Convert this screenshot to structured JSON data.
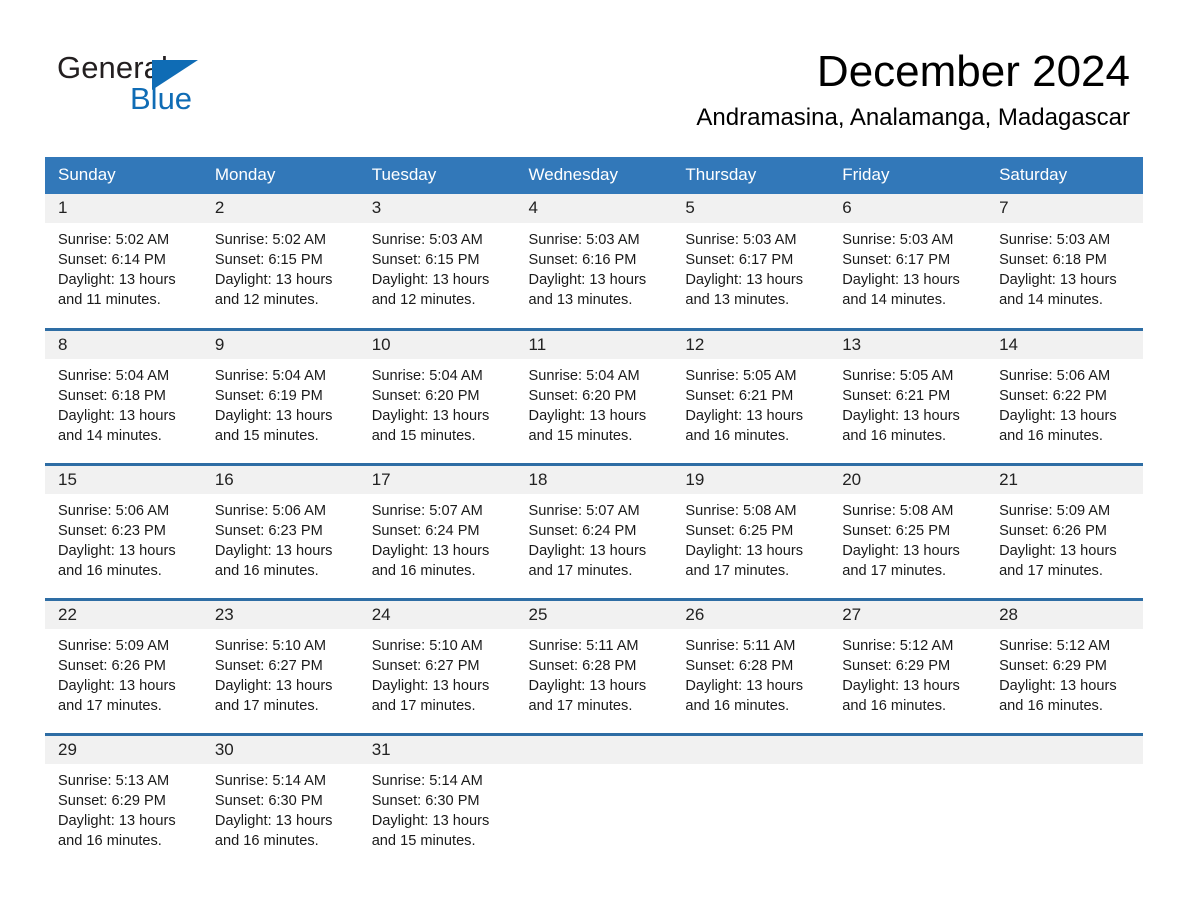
{
  "brand": {
    "name_part1": "General",
    "name_part2": "Blue",
    "accent_color": "#0f6cb5"
  },
  "header": {
    "title": "December 2024",
    "subtitle": "Andramasina, Analamanga, Madagascar"
  },
  "theme": {
    "header_row_bg": "#3278b9",
    "row_divider": "#2e6da4",
    "daynum_bg": "#f1f1f1",
    "page_bg": "#ffffff"
  },
  "weekday_headers": [
    "Sunday",
    "Monday",
    "Tuesday",
    "Wednesday",
    "Thursday",
    "Friday",
    "Saturday"
  ],
  "labels": {
    "sunrise_prefix": "Sunrise:",
    "sunset_prefix": "Sunset:",
    "daylight_prefix": "Daylight:"
  },
  "weeks": [
    [
      {
        "day": "1",
        "sunrise": "Sunrise: 5:02 AM",
        "sunset": "Sunset: 6:14 PM",
        "daylight_l1": "Daylight: 13 hours",
        "daylight_l2": "and 11 minutes."
      },
      {
        "day": "2",
        "sunrise": "Sunrise: 5:02 AM",
        "sunset": "Sunset: 6:15 PM",
        "daylight_l1": "Daylight: 13 hours",
        "daylight_l2": "and 12 minutes."
      },
      {
        "day": "3",
        "sunrise": "Sunrise: 5:03 AM",
        "sunset": "Sunset: 6:15 PM",
        "daylight_l1": "Daylight: 13 hours",
        "daylight_l2": "and 12 minutes."
      },
      {
        "day": "4",
        "sunrise": "Sunrise: 5:03 AM",
        "sunset": "Sunset: 6:16 PM",
        "daylight_l1": "Daylight: 13 hours",
        "daylight_l2": "and 13 minutes."
      },
      {
        "day": "5",
        "sunrise": "Sunrise: 5:03 AM",
        "sunset": "Sunset: 6:17 PM",
        "daylight_l1": "Daylight: 13 hours",
        "daylight_l2": "and 13 minutes."
      },
      {
        "day": "6",
        "sunrise": "Sunrise: 5:03 AM",
        "sunset": "Sunset: 6:17 PM",
        "daylight_l1": "Daylight: 13 hours",
        "daylight_l2": "and 14 minutes."
      },
      {
        "day": "7",
        "sunrise": "Sunrise: 5:03 AM",
        "sunset": "Sunset: 6:18 PM",
        "daylight_l1": "Daylight: 13 hours",
        "daylight_l2": "and 14 minutes."
      }
    ],
    [
      {
        "day": "8",
        "sunrise": "Sunrise: 5:04 AM",
        "sunset": "Sunset: 6:18 PM",
        "daylight_l1": "Daylight: 13 hours",
        "daylight_l2": "and 14 minutes."
      },
      {
        "day": "9",
        "sunrise": "Sunrise: 5:04 AM",
        "sunset": "Sunset: 6:19 PM",
        "daylight_l1": "Daylight: 13 hours",
        "daylight_l2": "and 15 minutes."
      },
      {
        "day": "10",
        "sunrise": "Sunrise: 5:04 AM",
        "sunset": "Sunset: 6:20 PM",
        "daylight_l1": "Daylight: 13 hours",
        "daylight_l2": "and 15 minutes."
      },
      {
        "day": "11",
        "sunrise": "Sunrise: 5:04 AM",
        "sunset": "Sunset: 6:20 PM",
        "daylight_l1": "Daylight: 13 hours",
        "daylight_l2": "and 15 minutes."
      },
      {
        "day": "12",
        "sunrise": "Sunrise: 5:05 AM",
        "sunset": "Sunset: 6:21 PM",
        "daylight_l1": "Daylight: 13 hours",
        "daylight_l2": "and 16 minutes."
      },
      {
        "day": "13",
        "sunrise": "Sunrise: 5:05 AM",
        "sunset": "Sunset: 6:21 PM",
        "daylight_l1": "Daylight: 13 hours",
        "daylight_l2": "and 16 minutes."
      },
      {
        "day": "14",
        "sunrise": "Sunrise: 5:06 AM",
        "sunset": "Sunset: 6:22 PM",
        "daylight_l1": "Daylight: 13 hours",
        "daylight_l2": "and 16 minutes."
      }
    ],
    [
      {
        "day": "15",
        "sunrise": "Sunrise: 5:06 AM",
        "sunset": "Sunset: 6:23 PM",
        "daylight_l1": "Daylight: 13 hours",
        "daylight_l2": "and 16 minutes."
      },
      {
        "day": "16",
        "sunrise": "Sunrise: 5:06 AM",
        "sunset": "Sunset: 6:23 PM",
        "daylight_l1": "Daylight: 13 hours",
        "daylight_l2": "and 16 minutes."
      },
      {
        "day": "17",
        "sunrise": "Sunrise: 5:07 AM",
        "sunset": "Sunset: 6:24 PM",
        "daylight_l1": "Daylight: 13 hours",
        "daylight_l2": "and 16 minutes."
      },
      {
        "day": "18",
        "sunrise": "Sunrise: 5:07 AM",
        "sunset": "Sunset: 6:24 PM",
        "daylight_l1": "Daylight: 13 hours",
        "daylight_l2": "and 17 minutes."
      },
      {
        "day": "19",
        "sunrise": "Sunrise: 5:08 AM",
        "sunset": "Sunset: 6:25 PM",
        "daylight_l1": "Daylight: 13 hours",
        "daylight_l2": "and 17 minutes."
      },
      {
        "day": "20",
        "sunrise": "Sunrise: 5:08 AM",
        "sunset": "Sunset: 6:25 PM",
        "daylight_l1": "Daylight: 13 hours",
        "daylight_l2": "and 17 minutes."
      },
      {
        "day": "21",
        "sunrise": "Sunrise: 5:09 AM",
        "sunset": "Sunset: 6:26 PM",
        "daylight_l1": "Daylight: 13 hours",
        "daylight_l2": "and 17 minutes."
      }
    ],
    [
      {
        "day": "22",
        "sunrise": "Sunrise: 5:09 AM",
        "sunset": "Sunset: 6:26 PM",
        "daylight_l1": "Daylight: 13 hours",
        "daylight_l2": "and 17 minutes."
      },
      {
        "day": "23",
        "sunrise": "Sunrise: 5:10 AM",
        "sunset": "Sunset: 6:27 PM",
        "daylight_l1": "Daylight: 13 hours",
        "daylight_l2": "and 17 minutes."
      },
      {
        "day": "24",
        "sunrise": "Sunrise: 5:10 AM",
        "sunset": "Sunset: 6:27 PM",
        "daylight_l1": "Daylight: 13 hours",
        "daylight_l2": "and 17 minutes."
      },
      {
        "day": "25",
        "sunrise": "Sunrise: 5:11 AM",
        "sunset": "Sunset: 6:28 PM",
        "daylight_l1": "Daylight: 13 hours",
        "daylight_l2": "and 17 minutes."
      },
      {
        "day": "26",
        "sunrise": "Sunrise: 5:11 AM",
        "sunset": "Sunset: 6:28 PM",
        "daylight_l1": "Daylight: 13 hours",
        "daylight_l2": "and 16 minutes."
      },
      {
        "day": "27",
        "sunrise": "Sunrise: 5:12 AM",
        "sunset": "Sunset: 6:29 PM",
        "daylight_l1": "Daylight: 13 hours",
        "daylight_l2": "and 16 minutes."
      },
      {
        "day": "28",
        "sunrise": "Sunrise: 5:12 AM",
        "sunset": "Sunset: 6:29 PM",
        "daylight_l1": "Daylight: 13 hours",
        "daylight_l2": "and 16 minutes."
      }
    ],
    [
      {
        "day": "29",
        "sunrise": "Sunrise: 5:13 AM",
        "sunset": "Sunset: 6:29 PM",
        "daylight_l1": "Daylight: 13 hours",
        "daylight_l2": "and 16 minutes."
      },
      {
        "day": "30",
        "sunrise": "Sunrise: 5:14 AM",
        "sunset": "Sunset: 6:30 PM",
        "daylight_l1": "Daylight: 13 hours",
        "daylight_l2": "and 16 minutes."
      },
      {
        "day": "31",
        "sunrise": "Sunrise: 5:14 AM",
        "sunset": "Sunset: 6:30 PM",
        "daylight_l1": "Daylight: 13 hours",
        "daylight_l2": "and 15 minutes."
      },
      {
        "day": "",
        "sunrise": "",
        "sunset": "",
        "daylight_l1": "",
        "daylight_l2": ""
      },
      {
        "day": "",
        "sunrise": "",
        "sunset": "",
        "daylight_l1": "",
        "daylight_l2": ""
      },
      {
        "day": "",
        "sunrise": "",
        "sunset": "",
        "daylight_l1": "",
        "daylight_l2": ""
      },
      {
        "day": "",
        "sunrise": "",
        "sunset": "",
        "daylight_l1": "",
        "daylight_l2": ""
      }
    ]
  ]
}
